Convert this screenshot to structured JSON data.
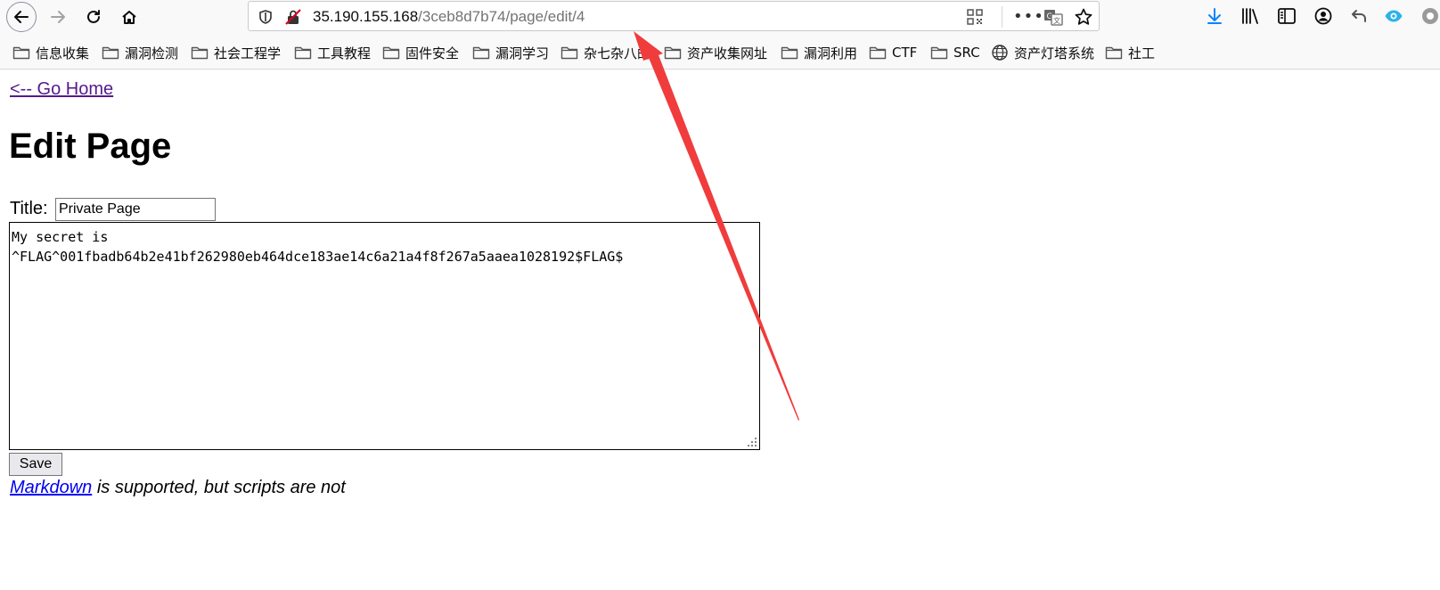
{
  "browser": {
    "url_host": "35.190.155.168",
    "url_path": "/3ceb8d7b74/page/edit/4",
    "url_more": "•••",
    "accent_color": "#0a84ff"
  },
  "bookmarks": [
    {
      "label": "信息收集",
      "icon": "folder-icon"
    },
    {
      "label": "漏洞检测",
      "icon": "folder-icon"
    },
    {
      "label": "社会工程学",
      "icon": "folder-icon"
    },
    {
      "label": "工具教程",
      "icon": "folder-icon"
    },
    {
      "label": "固件安全",
      "icon": "folder-icon"
    },
    {
      "label": "漏洞学习",
      "icon": "folder-icon"
    },
    {
      "label": "杂七杂八的",
      "icon": "folder-icon"
    },
    {
      "label": "资产收集网址",
      "icon": "folder-icon"
    },
    {
      "label": "漏洞利用",
      "icon": "folder-icon"
    },
    {
      "label": "CTF",
      "icon": "folder-icon"
    },
    {
      "label": "SRC",
      "icon": "folder-icon"
    },
    {
      "label": "资产灯塔系统",
      "icon": "globe-icon"
    },
    {
      "label": "社工",
      "icon": "folder-icon"
    }
  ],
  "page": {
    "home_link": "<-- Go Home",
    "heading": "Edit Page",
    "title_label": "Title:",
    "title_value": "Private Page",
    "body_value": "My secret is\n^FLAG^001fbadb64b2e41bf262980eb464dce183ae14c6a21a4f8f267a5aaea1028192$FLAG$",
    "save_label": "Save",
    "markdown_link": "Markdown",
    "note_text": " is supported, but scripts are not"
  },
  "annotation": {
    "arrow_color": "#f03c3c"
  }
}
